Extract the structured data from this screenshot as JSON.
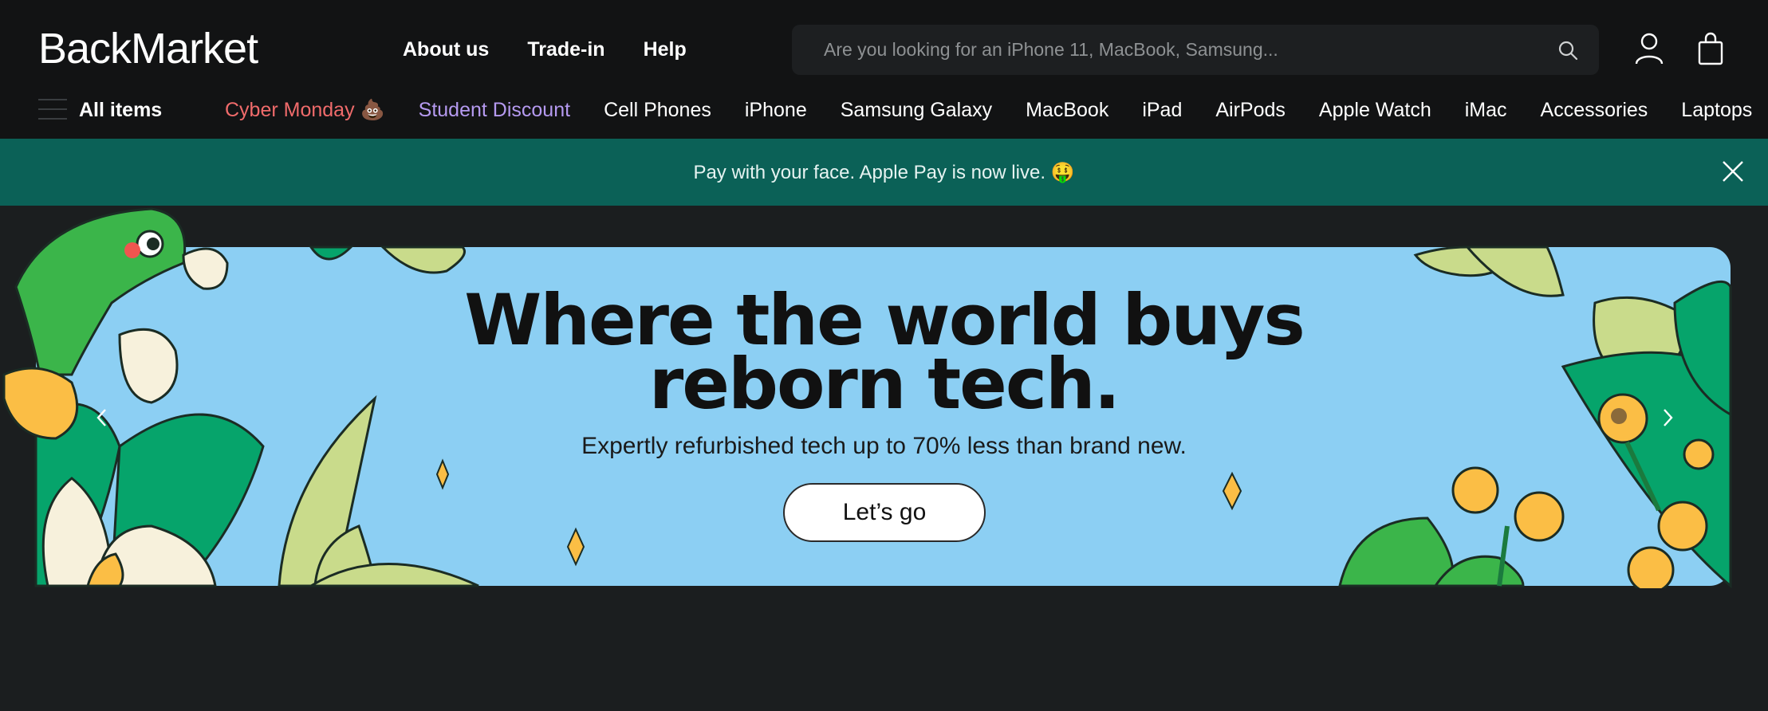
{
  "brand": {
    "logo_text": "BackMarket"
  },
  "top_nav": {
    "about": "About us",
    "trade_in": "Trade-in",
    "help": "Help"
  },
  "search": {
    "placeholder": "Are you looking for an iPhone 11, MacBook, Samsung..."
  },
  "categories": {
    "all_items": "All items",
    "items": [
      "Cyber Monday 💩",
      "Student Discount",
      "Cell Phones",
      "iPhone",
      "Samsung Galaxy",
      "MacBook",
      "iPad",
      "AirPods",
      "Apple Watch",
      "iMac",
      "Accessories",
      "Laptops"
    ]
  },
  "announcement": {
    "text": "Pay with your face. Apple Pay is now live. 🤑"
  },
  "hero": {
    "title_line1": "Where the world buys",
    "title_line2": "reborn tech.",
    "subtitle": "Expertly refurbished tech up to 70% less than brand new.",
    "cta": "Let’s go"
  },
  "colors": {
    "topbar": "#121314",
    "banner": "#0b6157",
    "hero_bg": "#8ccff3",
    "cyber_monday": "#f06b6b",
    "student_discount": "#b59af0"
  },
  "icons": [
    "search-icon",
    "user-icon",
    "cart-icon",
    "menu-icon",
    "close-icon",
    "chevron-left-icon",
    "chevron-right-icon"
  ]
}
